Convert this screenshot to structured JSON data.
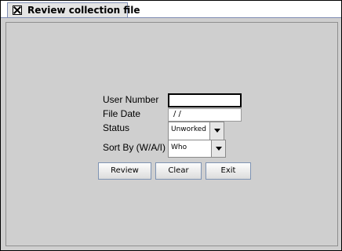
{
  "window": {
    "tab_title": "Review collection file",
    "close_icon": "close-icon"
  },
  "form": {
    "user_number_label": "User Number",
    "user_number_value": "",
    "file_date_label": "File Date",
    "file_date_value": " / /",
    "status_label": "Status",
    "status_value": "Unworked",
    "sort_by_label": "Sort By (W/A/I)",
    "sort_by_value": "Who"
  },
  "buttons": {
    "review": "Review",
    "clear": "Clear",
    "exit": "Exit"
  }
}
